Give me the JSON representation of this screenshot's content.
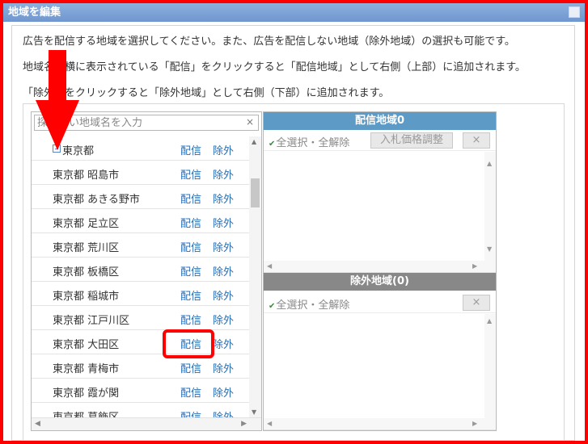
{
  "window": {
    "title": "地域を編集"
  },
  "description": [
    "広告を配信する地域を選択してください。また、広告を配信しない地域（除外地域）の選択も可能です。",
    "地域名の横に表示されている「配信」をクリックすると「配信地域」として右側（上部）に追加されます。",
    "「除外」をクリックすると「除外地域」として右側（下部）に追加されます。"
  ],
  "search": {
    "placeholder": "探したい地域名を入力",
    "clear_icon": "×"
  },
  "area_list": {
    "prefecture": "東京都",
    "deliver_label": "配信",
    "exclude_label": "除外",
    "items": [
      "東京都 昭島市",
      "東京都 あきる野市",
      "東京都 足立区",
      "東京都 荒川区",
      "東京都 板橋区",
      "東京都 稲城市",
      "東京都 江戸川区",
      "東京都 大田区",
      "東京都 青梅市",
      "東京都 霞が関",
      "東京都 葛飾区"
    ]
  },
  "delivery_panel": {
    "title": "配信地域0",
    "select_all": "全選択・全解除",
    "bid_button": "入札価格調整",
    "remove_button": "×"
  },
  "exclude_panel": {
    "title": "除外地域(0)",
    "select_all": "全選択・全解除",
    "remove_button": "×"
  },
  "annotation": {
    "highlight_color": "#ff0000",
    "highlight_target": "東京都 大田区 配信"
  }
}
